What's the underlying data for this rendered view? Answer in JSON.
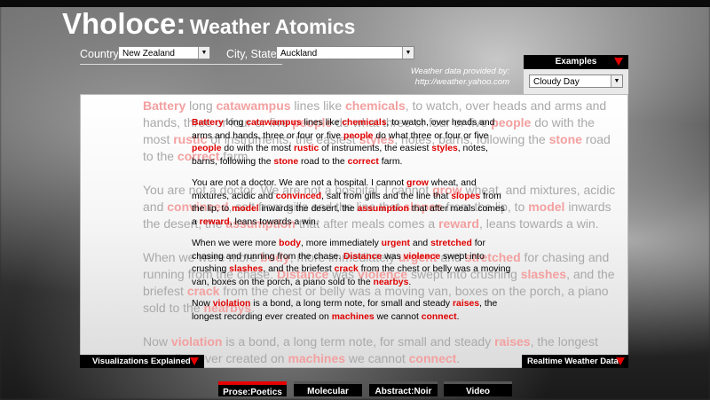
{
  "app": {
    "title_main": "Vholoce:",
    "title_sub": "Weather Atomics"
  },
  "location": {
    "country_label": "Country:",
    "country_value": "New Zealand",
    "city_label": "City, State:",
    "city_value": "Auckland"
  },
  "credit": {
    "line1": "Weather data provided by:",
    "line2": "http://weather.yahoo.com"
  },
  "examples": {
    "header": "Examples",
    "selected": "Cloudy Day"
  },
  "poem": {
    "stanzas": [
      [
        {
          "t": "Battery",
          "k": true
        },
        {
          "t": " long "
        },
        {
          "t": "catawampus",
          "k": true
        },
        {
          "t": " lines like "
        },
        {
          "t": "chemicals",
          "k": true
        },
        {
          "t": ", to watch, over heads and arms and hands, three or four or five "
        },
        {
          "t": "people",
          "k": true
        },
        {
          "t": " do what three or four or five "
        },
        {
          "t": "people",
          "k": true
        },
        {
          "t": " do with the most "
        },
        {
          "t": "rustic",
          "k": true
        },
        {
          "t": " of instruments, the easiest "
        },
        {
          "t": "styles",
          "k": true
        },
        {
          "t": ", notes, barns, following the "
        },
        {
          "t": "stone",
          "k": true
        },
        {
          "t": " road to the "
        },
        {
          "t": "correct",
          "k": true
        },
        {
          "t": " farm."
        }
      ],
      [
        {
          "t": "You are not a doctor. We are not a hospital. I cannot "
        },
        {
          "t": "grow",
          "k": true
        },
        {
          "t": " wheat, and mixtures, acidic and "
        },
        {
          "t": "convinced",
          "k": true
        },
        {
          "t": ", salt from gills and the line that "
        },
        {
          "t": "slopes",
          "k": true
        },
        {
          "t": " from the lip, to "
        },
        {
          "t": "model",
          "k": true
        },
        {
          "t": " inwards the desert, the "
        },
        {
          "t": "assumption",
          "k": true
        },
        {
          "t": " that after meals comes a "
        },
        {
          "t": "reward",
          "k": true
        },
        {
          "t": ", leans towards a win."
        }
      ],
      [
        {
          "t": "When we were more "
        },
        {
          "t": "body",
          "k": true
        },
        {
          "t": ", more immediately "
        },
        {
          "t": "urgent",
          "k": true
        },
        {
          "t": " and "
        },
        {
          "t": "stretched",
          "k": true
        },
        {
          "t": " for chasing and running from the chase. "
        },
        {
          "t": "Distance",
          "k": true
        },
        {
          "t": " was "
        },
        {
          "t": "violence",
          "k": true
        },
        {
          "t": " swept into crushing "
        },
        {
          "t": "slashes",
          "k": true
        },
        {
          "t": ", and the briefest "
        },
        {
          "t": "crack",
          "k": true
        },
        {
          "t": " from the chest or belly was a moving van, boxes on the porch, a piano sold to the "
        },
        {
          "t": "nearbys",
          "k": true
        },
        {
          "t": "."
        }
      ],
      [
        {
          "t": "Now "
        },
        {
          "t": "violation",
          "k": true
        },
        {
          "t": " is a bond, a long term note, for small and steady "
        },
        {
          "t": "raises",
          "k": true
        },
        {
          "t": ", the longest recording ever created on "
        },
        {
          "t": "machines",
          "k": true
        },
        {
          "t": " we cannot "
        },
        {
          "t": "connect",
          "k": true
        },
        {
          "t": "."
        }
      ]
    ]
  },
  "bars": {
    "left": "Visualizations Explained",
    "right": "Realtime Weather Data"
  },
  "tabs": [
    {
      "label": "Prose:Poetics",
      "active": true
    },
    {
      "label": "Molecular",
      "active": false
    },
    {
      "label": "Abstract:Noir",
      "active": false
    },
    {
      "label": "Video",
      "active": false
    }
  ],
  "colors": {
    "accent": "#e60000",
    "keyword": "#e00000",
    "ghost_keyword": "#f3a0a0"
  },
  "icons": {
    "dropdown": "chevron-down-icon",
    "panel_toggle": "red-triangle-icon"
  }
}
